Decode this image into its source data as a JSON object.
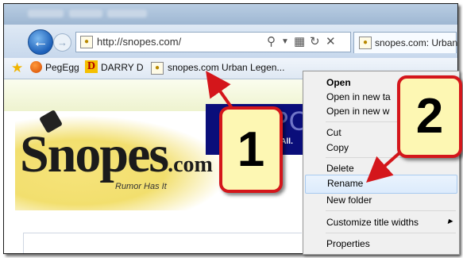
{
  "browser": {
    "address_url": "http://snopes.com/",
    "tab_title": "snopes.com: Urban ...",
    "nav_controls": [
      "search-icon",
      "dropdown-icon",
      "compat-icon",
      "refresh-icon",
      "stop-icon"
    ]
  },
  "favorites_bar": {
    "items": [
      {
        "label": "PegEgg",
        "icon": "pegegg-icon"
      },
      {
        "label": "DARRY D",
        "icon": "darry-d-icon"
      },
      {
        "label": "snopes.com Urban Legen...",
        "icon": "bulb-favicon"
      }
    ]
  },
  "page": {
    "logo_main": "Snopes",
    "logo_suffix": ".com",
    "tagline": "Rumor Has It",
    "banner_text": "PC",
    "banner_sub": "r All."
  },
  "context_menu": {
    "items": [
      {
        "label": "Open"
      },
      {
        "label": "Open in new ta"
      },
      {
        "label": "Open in new w"
      },
      {
        "label": "Cut"
      },
      {
        "label": "Copy"
      },
      {
        "label": "Delete"
      },
      {
        "label": "Rename"
      },
      {
        "label": "New folder"
      },
      {
        "label": "Customize title widths"
      },
      {
        "label": "Properties"
      }
    ],
    "highlighted": "Rename"
  },
  "callouts": {
    "one": "1",
    "two": "2"
  },
  "colors": {
    "callout_fill": "#fdf7b3",
    "callout_border": "#d4161b",
    "arrow": "#d4161b",
    "menu_highlight": "#dcebfc"
  }
}
